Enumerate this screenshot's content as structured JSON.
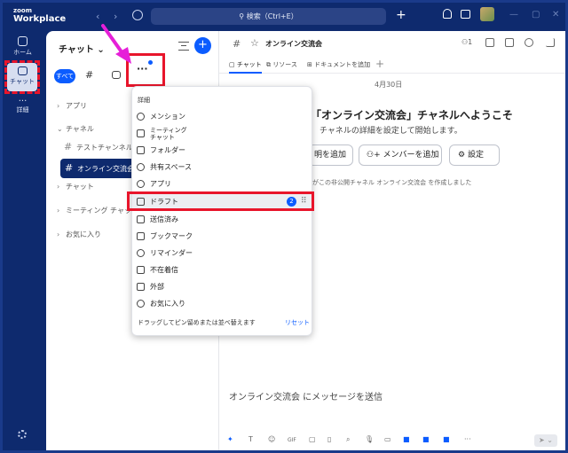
{
  "app": {
    "logo_line1": "zoom",
    "logo_line2": "Workplace",
    "search_placeholder": "検索（Ctrl+E）"
  },
  "rail": {
    "home": "ホーム",
    "chat": "チャット",
    "more": "詳細"
  },
  "panel": {
    "title": "チャット ⌄",
    "tabs": {
      "all": "すべて",
      "more": "···"
    },
    "sections": {
      "apps": "アプリ",
      "channels": "チャネル",
      "chats": "チャット",
      "meeting_chats": "ミーティング チャット",
      "favorites": "お気に入り"
    },
    "channels": [
      {
        "name": "テストチャンネル"
      },
      {
        "name": "オンライン交流会"
      }
    ]
  },
  "main": {
    "title": "オンライン交流会",
    "member_count": "1",
    "tabs": [
      "チャット",
      "リソース",
      "ドキュメントを追加"
    ],
    "date": "4月30日",
    "welcome": "「オンライン交流会」チャネルへようこそ",
    "subtitle": "チャネルの詳細を設定して開始します。",
    "buttons": {
      "description": "明を追加",
      "add_member": "メンバーを追加",
      "settings": "設定"
    },
    "info_text": "がこの非公開チャネル オンライン交流会 を作成しました",
    "composer_placeholder": "オンライン交流会 にメッセージを送信",
    "toolbar": [
      "T",
      "☺",
      "GIF",
      "▢",
      "🎙",
      "···"
    ]
  },
  "menu": {
    "header": "詳細",
    "items": [
      {
        "label": "メンション",
        "icon": "at-icon"
      },
      {
        "label": "ミーティング\nチャット",
        "icon": "calendar-icon"
      },
      {
        "label": "フォルダー",
        "icon": "folder-icon"
      },
      {
        "label": "共有スペース",
        "icon": "share-icon"
      },
      {
        "label": "アプリ",
        "icon": "app-icon"
      },
      {
        "label": "ドラフト",
        "icon": "draft-icon",
        "badge": "2"
      },
      {
        "label": "送信済み",
        "icon": "send-icon"
      },
      {
        "label": "ブックマーク",
        "icon": "bookmark-icon"
      },
      {
        "label": "リマインダー",
        "icon": "alarm-icon"
      },
      {
        "label": "不在着信",
        "icon": "missed-call-icon"
      },
      {
        "label": "外部",
        "icon": "external-icon"
      },
      {
        "label": "お気に入り",
        "icon": "star-icon"
      }
    ],
    "footer": "ドラッグしてピン留めまたは並べ替えます",
    "reset": "リセット"
  },
  "colors": {
    "navy": "#0e2a6e",
    "accent": "#0b5cff",
    "highlight_red": "#e8152b",
    "arrow_pink": "#e61fd8"
  }
}
